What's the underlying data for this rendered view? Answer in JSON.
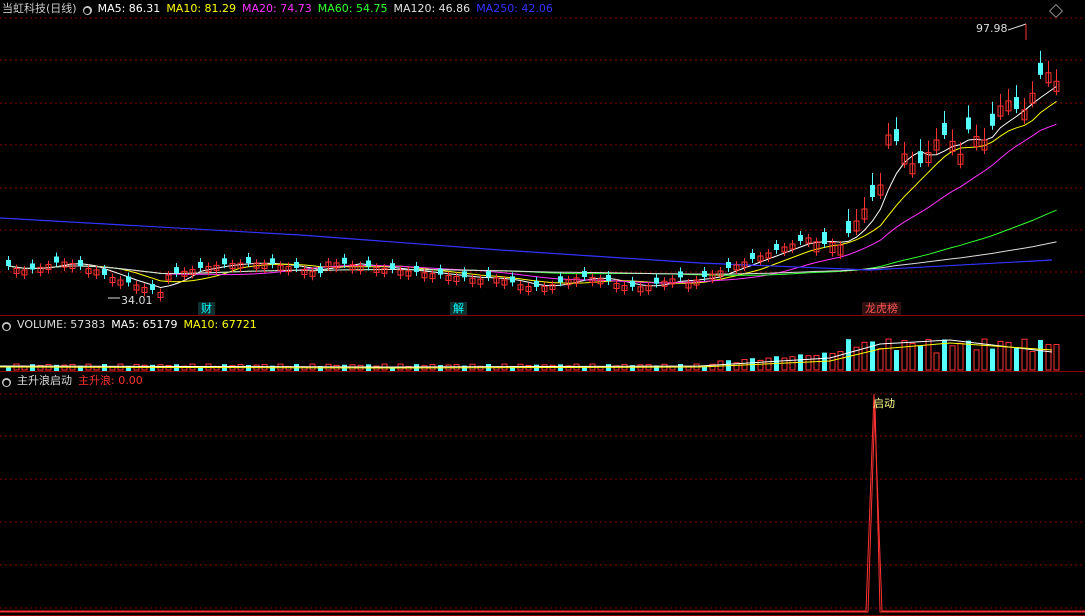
{
  "price_panel": {
    "title": "当虹科技(日线)",
    "indicators": [
      {
        "label": "MA5: 86.31",
        "color": "#ffffff"
      },
      {
        "label": "MA10: 81.29",
        "color": "#ffff00"
      },
      {
        "label": "MA20: 74.73",
        "color": "#ff33ff"
      },
      {
        "label": "MA60: 54.75",
        "color": "#33ff33"
      },
      {
        "label": "MA120: 46.86",
        "color": "#e0e0e0"
      },
      {
        "label": "MA250: 42.06",
        "color": "#3333ff"
      }
    ],
    "high_label": "97.98",
    "low_label": "34.01",
    "event_tags": [
      {
        "text": "财",
        "color": "#00ffff"
      },
      {
        "text": "解",
        "color": "#00ffff"
      },
      {
        "text": "龙虎榜",
        "color": "#ff5555"
      }
    ]
  },
  "volume_panel": {
    "title": "VOLUME: 57383",
    "ma5": "MA5: 65179",
    "ma10": "MA10: 67721"
  },
  "signal_panel": {
    "title": "主升浪启动",
    "series_label": "主升浪: 0.00",
    "annotation": "启动"
  },
  "colors": {
    "up": "#ff3333",
    "down": "#54ffff",
    "grid": "#8b0000",
    "background": "#000000"
  },
  "icons": [
    "settings-diamond-icon",
    "indicator-circle-icon"
  ]
}
